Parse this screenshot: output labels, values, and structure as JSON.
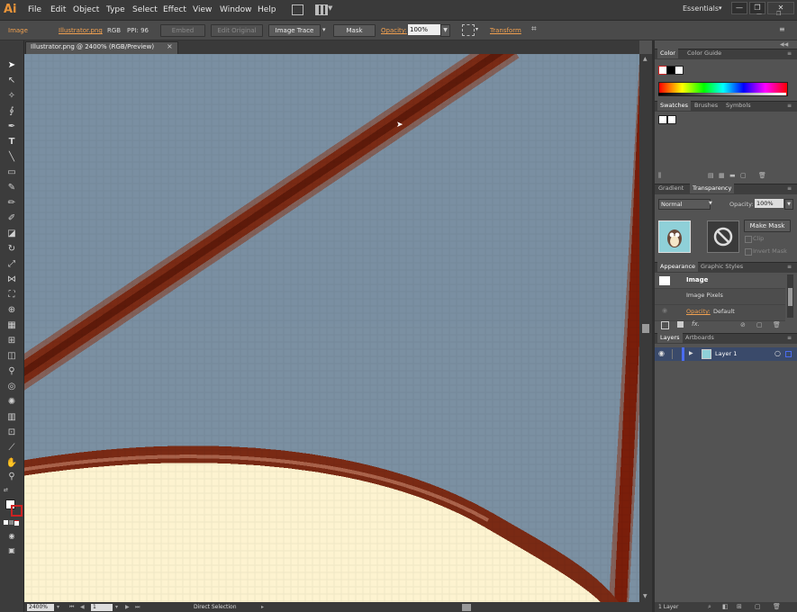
{
  "menubar": {
    "logo": "Ai",
    "items": [
      "File",
      "Edit",
      "Object",
      "Type",
      "Select",
      "Effect",
      "View",
      "Window",
      "Help"
    ],
    "workspace": "Essentials",
    "window_buttons": [
      "—",
      "❐",
      "✕"
    ],
    "second_row_buttons": [
      "—",
      "❐"
    ]
  },
  "control_bar": {
    "object_type": "Image",
    "file_link": "Illustrator.png",
    "color_mode": "RGB",
    "ppi": "PPI: 96",
    "embed_label": "Embed",
    "edit_original_label": "Edit Original",
    "image_trace_label": "Image Trace",
    "mask_label": "Mask",
    "opacity_label": "Opacity:",
    "opacity_value": "100%",
    "transform_label": "Transform"
  },
  "document": {
    "tab_title": "Illustrator.png @ 2400% (RGB/Preview)",
    "close_glyph": "×"
  },
  "status_bar": {
    "zoom": "2400%",
    "page": "1",
    "tool_name": "Direct Selection"
  },
  "panels": {
    "color": {
      "tabs": [
        "Color",
        "Color Guide"
      ]
    },
    "swatches": {
      "tabs": [
        "Swatches",
        "Brushes",
        "Symbols"
      ]
    },
    "transparency": {
      "tabs": [
        "Gradient",
        "Transparency"
      ],
      "blend_mode": "Normal",
      "opacity_label": "Opacity:",
      "opacity_value": "100%",
      "make_mask_label": "Make Mask",
      "clip_label": "Clip",
      "invert_mask_label": "Invert Mask"
    },
    "appearance": {
      "tabs": [
        "Appearance",
        "Graphic Styles"
      ],
      "title": "Image",
      "row_pixels": "Image Pixels",
      "opacity_label": "Opacity:",
      "opacity_value": "Default",
      "fx_label": "fx."
    },
    "layers": {
      "tabs": [
        "Layers",
        "Artboards"
      ],
      "layer_name": "Layer 1",
      "count_label": "1 Layer"
    }
  },
  "colors": {
    "accent_orange": "#f0a050",
    "canvas_sky": "#7b90a2",
    "stroke_brown": "#7a2a14",
    "cream": "#fdf3d0",
    "layer_highlight": "#3a4a6a"
  }
}
